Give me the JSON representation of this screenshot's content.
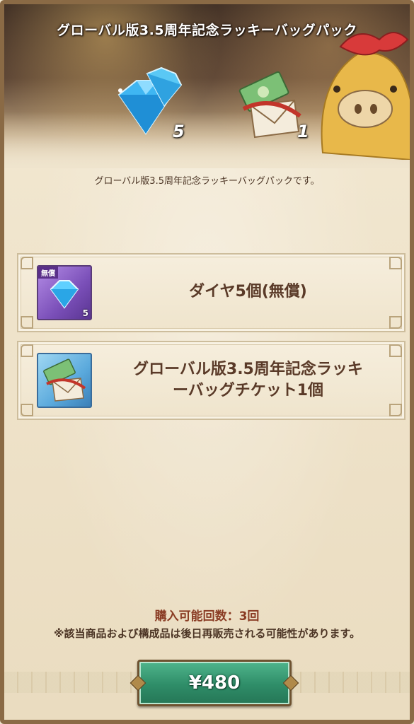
{
  "header": {
    "title": "グローバル版3.5周年記念ラッキーバッグパック",
    "gem_count": "5",
    "ticket_count": "1"
  },
  "description": "グローバル版3.5周年記念ラッキーバッグパックです。",
  "items": [
    {
      "icon": "diamond-icon",
      "tag": "無償",
      "count": "5",
      "label": "ダイヤ5個(無償)"
    },
    {
      "icon": "ticket-envelope-icon",
      "label_line1": "グローバル版3.5周年記念ラッキ",
      "label_line2": "ーバッグチケット1個"
    }
  ],
  "purchase_limit": "購入可能回数：3回",
  "notice": "※該当商品および構成品は後日再販売される可能性があります。",
  "price_button": {
    "label": "¥480"
  },
  "colors": {
    "accent_green": "#2f8d68",
    "text_brown": "#5a3a28",
    "limit_red": "#8a3c24",
    "gem_blue": "#3fb6f2"
  }
}
